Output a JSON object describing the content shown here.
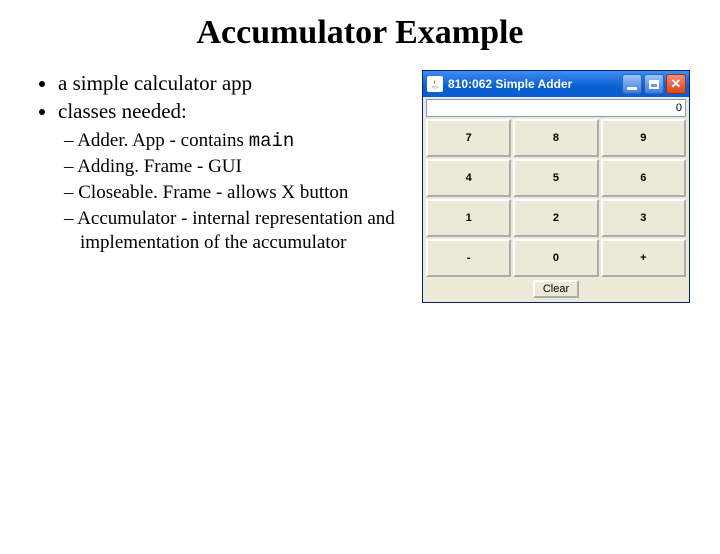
{
  "title": "Accumulator Example",
  "bullets": {
    "b1": "a simple calculator app",
    "b2": "classes needed:",
    "d1_pre": "Adder. App - contains ",
    "d1_code": "main",
    "d2": "Adding. Frame - GUI",
    "d3": "Closeable. Frame - allows X button",
    "d4": "Accumulator - internal representation and implementation of the accumulator"
  },
  "app": {
    "window_title": "810:062 Simple Adder",
    "display_value": "0",
    "keys": {
      "k7": "7",
      "k8": "8",
      "k9": "9",
      "k4": "4",
      "k5": "5",
      "k6": "6",
      "k1": "1",
      "k2": "2",
      "k3": "3",
      "kminus": "-",
      "k0": "0",
      "kplus": "+"
    },
    "clear_label": "Clear"
  }
}
